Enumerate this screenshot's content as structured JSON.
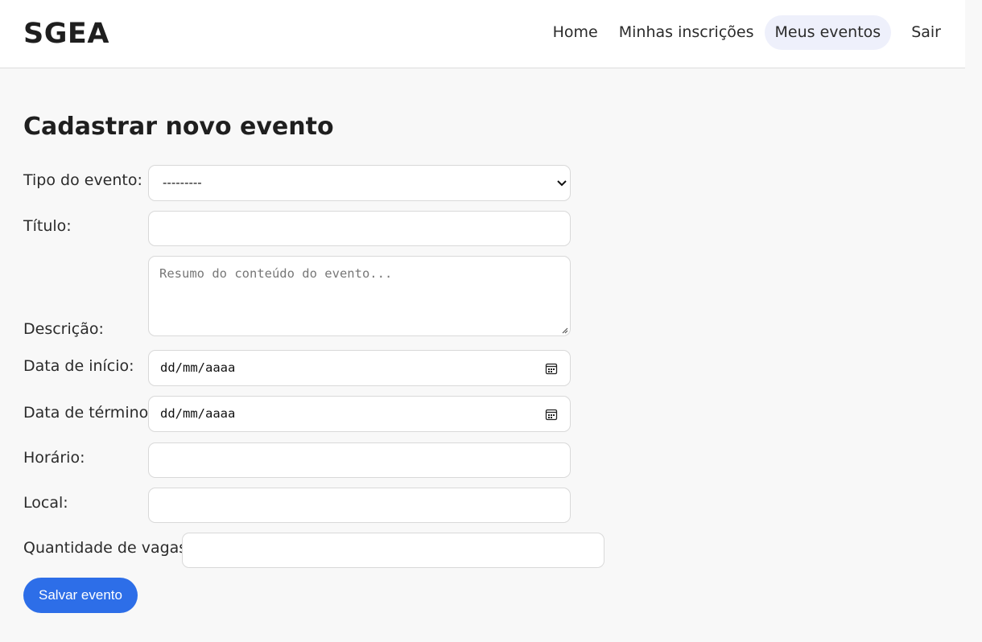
{
  "header": {
    "brand": "SGEA",
    "nav": {
      "home": "Home",
      "minhas_inscricoes": "Minhas inscrições",
      "meus_eventos": "Meus eventos",
      "sair": "Sair"
    },
    "active_nav": "Meus eventos"
  },
  "main": {
    "title": "Cadastrar novo evento",
    "form": {
      "tipo_label": "Tipo do evento:",
      "tipo_value": "---------",
      "titulo_label": "Título:",
      "titulo_value": "",
      "descricao_label": "Descrição:",
      "descricao_placeholder": "Resumo do conteúdo do evento...",
      "data_inicio_label": "Data de início:",
      "data_inicio_value": "dd/mm/aaaa",
      "data_termino_label": "Data de término:",
      "data_termino_value": "dd/mm/aaaa",
      "horario_label": "Horário:",
      "horario_value": "",
      "local_label": "Local:",
      "local_value": "",
      "vagas_label": "Quantidade de vagas:",
      "vagas_value": "",
      "submit_label": "Salvar evento"
    }
  },
  "colors": {
    "accent": "#2d6ee8",
    "active_nav_bg": "#eef0fb",
    "page_bg": "#f8f8f8"
  },
  "icons": {
    "select": "chevron-down-icon",
    "date": "calendar-icon",
    "textarea": "resize-handle-icon"
  }
}
